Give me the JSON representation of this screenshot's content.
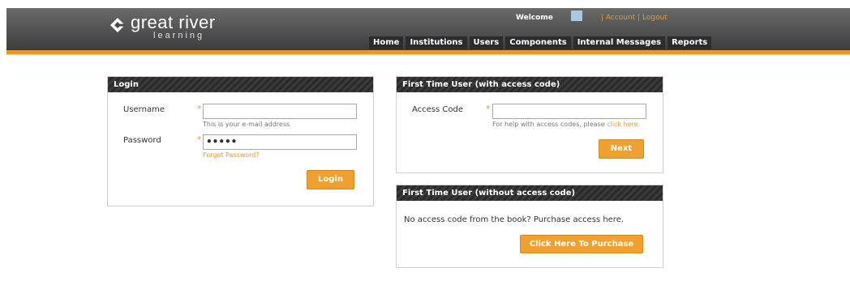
{
  "brand": {
    "name": "great river",
    "tagline": "learning"
  },
  "top_bar": {
    "welcome": "Welcome",
    "account": "| Account",
    "logout": "| Logout"
  },
  "nav": {
    "items": [
      "Home",
      "Institutions",
      "Users",
      "Components",
      "Internal Messages",
      "Reports"
    ]
  },
  "login": {
    "title": "Login",
    "username_label": "Username",
    "username_value": "",
    "username_hint": "This is your e-mail address",
    "password_label": "Password",
    "password_value": "•••••",
    "forgot": "Forgot Password?",
    "button": "Login"
  },
  "access_code": {
    "title": "First Time User (with access code)",
    "label": "Access Code",
    "value": "",
    "hint": "For help with access codes, please",
    "hint_link": "click here.",
    "button": "Next"
  },
  "purchase": {
    "title": "First Time User (without access code)",
    "text": "No access code from the book? Purchase access here.",
    "button": "Click Here To Purchase"
  },
  "required_mark": "*",
  "colors": {
    "accent": "#e8972a",
    "header_dark": "#3d3d3d",
    "panel_header": "#2a2a2a"
  }
}
